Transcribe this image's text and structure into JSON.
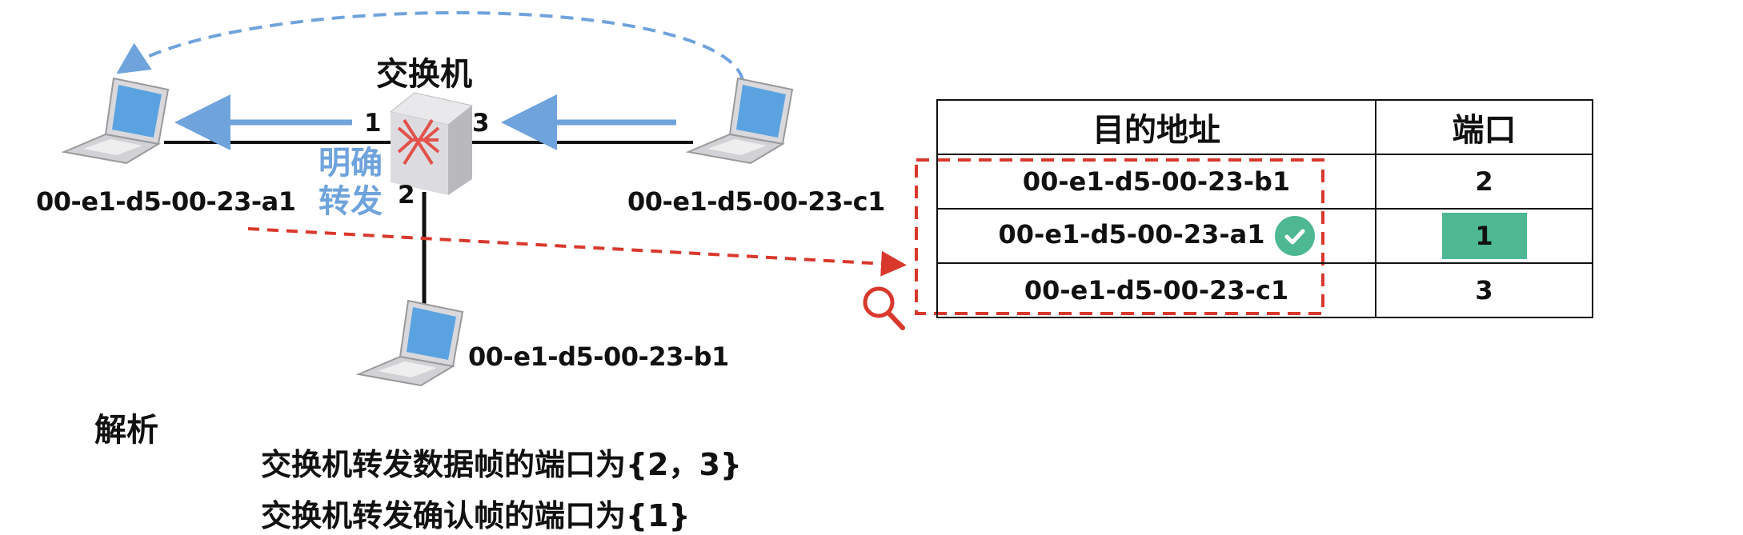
{
  "switch": {
    "label": "交换机",
    "forward_label_line1": "明确",
    "forward_label_line2": "转发"
  },
  "hosts": {
    "a1": "00-e1-d5-00-23-a1",
    "b1": "00-e1-d5-00-23-b1",
    "c1": "00-e1-d5-00-23-c1"
  },
  "ports": {
    "p1": "1",
    "p2": "2",
    "p3": "3"
  },
  "mac_table": {
    "headers": {
      "address": "目的地址",
      "port": "端口"
    },
    "rows": [
      {
        "address": "00-e1-d5-00-23-b1",
        "port": "2"
      },
      {
        "address": "00-e1-d5-00-23-a1",
        "port": "1"
      },
      {
        "address": "00-e1-d5-00-23-c1",
        "port": "3"
      }
    ]
  },
  "analysis": {
    "title": "解析",
    "line1": "交换机转发数据帧的端口为{2，3}",
    "line2": "交换机转发确认帧的端口为{1}"
  },
  "colors": {
    "arrow_blue": "#6fa3dc",
    "dashed_red": "#d9382c",
    "highlight_green": "#4db892",
    "laptop_screen": "#5aa3e0"
  }
}
